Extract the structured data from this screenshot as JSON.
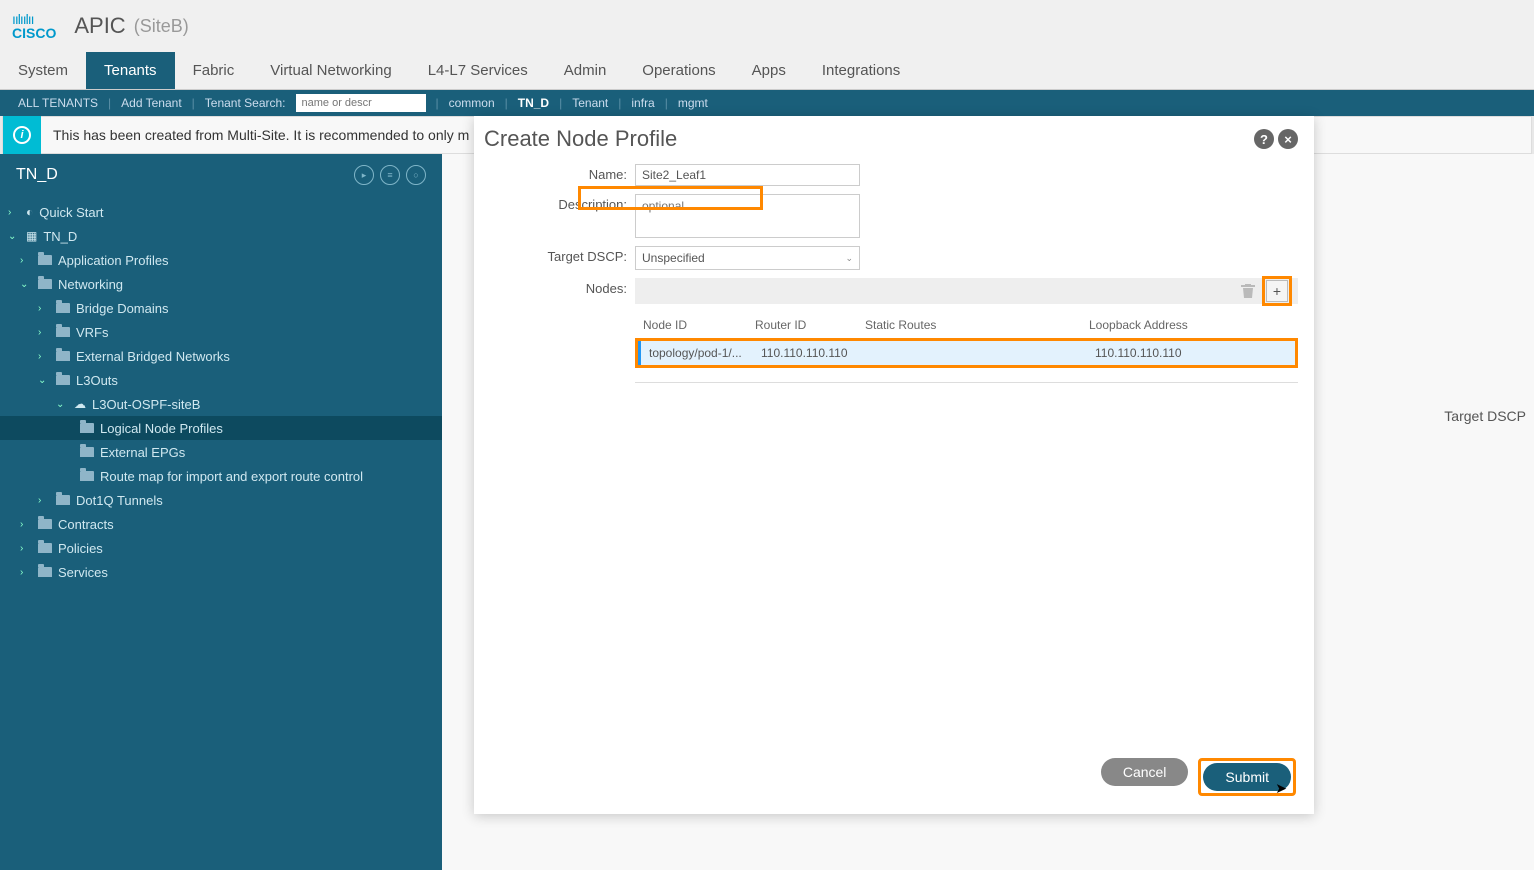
{
  "header": {
    "app_title": "APIC",
    "site": "(SiteB)"
  },
  "nav": {
    "items": [
      "System",
      "Tenants",
      "Fabric",
      "Virtual Networking",
      "L4-L7 Services",
      "Admin",
      "Operations",
      "Apps",
      "Integrations"
    ],
    "active": "Tenants"
  },
  "subnav": {
    "all_tenants": "ALL TENANTS",
    "add_tenant": "Add Tenant",
    "tenant_search_label": "Tenant Search:",
    "tenant_search_placeholder": "name or descr",
    "quick": [
      "common",
      "TN_D",
      "Tenant",
      "infra",
      "mgmt"
    ]
  },
  "banner": {
    "text": "This has been created from Multi-Site. It is recommended to only m"
  },
  "sidebar": {
    "title": "TN_D",
    "quick_start": "Quick Start",
    "root": "TN_D",
    "items": {
      "app_profiles": "Application Profiles",
      "networking": "Networking",
      "bridge": "Bridge Domains",
      "vrfs": "VRFs",
      "ext_bridged": "External Bridged Networks",
      "l3outs": "L3Outs",
      "l3out_ospf": "L3Out-OSPF-siteB",
      "logical_node": "Logical Node Profiles",
      "external_epgs": "External EPGs",
      "route_map": "Route map for import and export route control",
      "dot1q": "Dot1Q Tunnels",
      "contracts": "Contracts",
      "policies": "Policies",
      "services": "Services"
    }
  },
  "modal": {
    "title": "Create Node Profile",
    "labels": {
      "name": "Name:",
      "description": "Description:",
      "target_dscp": "Target DSCP:",
      "nodes": "Nodes:"
    },
    "values": {
      "name": "Site2_Leaf1",
      "description_placeholder": "optional",
      "target_dscp": "Unspecified"
    },
    "table": {
      "headers": {
        "node_id": "Node ID",
        "router_id": "Router ID",
        "static_routes": "Static Routes",
        "loopback": "Loopback Address"
      },
      "row": {
        "node_id": "topology/pod-1/...",
        "router_id": "110.110.110.110",
        "static_routes": "",
        "loopback": "110.110.110.110"
      }
    },
    "buttons": {
      "cancel": "Cancel",
      "submit": "Submit"
    }
  },
  "right_peek": "Target DSCP"
}
